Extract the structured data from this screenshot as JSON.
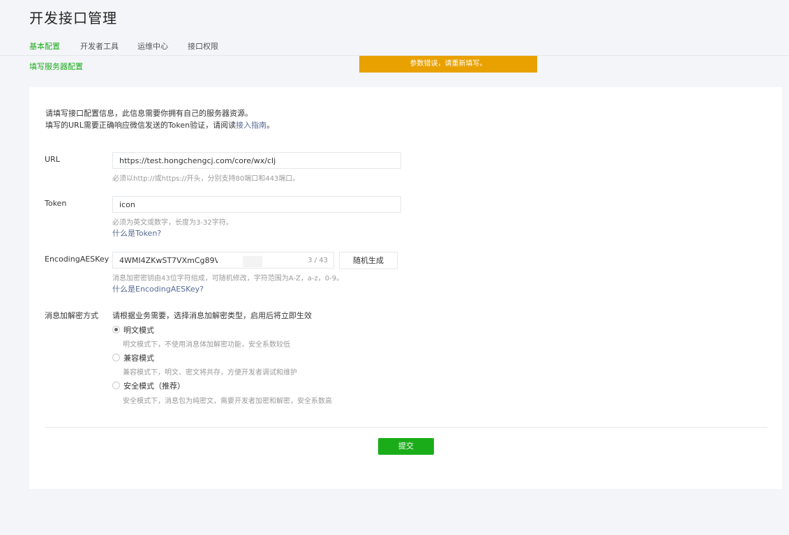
{
  "page": {
    "title": "开发接口管理"
  },
  "tabs": [
    {
      "label": "基本配置",
      "active": true
    },
    {
      "label": "开发者工具",
      "active": false
    },
    {
      "label": "运维中心",
      "active": false
    },
    {
      "label": "接口权限",
      "active": false
    }
  ],
  "sub_link": "填写服务器配置",
  "toast": "参数错误，请重新填写。",
  "intro": {
    "line1": "请填写接口配置信息，此信息需要你拥有自己的服务器资源。",
    "line2_prefix": "填写的URL需要正确响应微信发送的Token验证，请阅读",
    "line2_link": "接入指南",
    "line2_suffix": "。"
  },
  "url": {
    "label": "URL",
    "value": "https://test.hongchengcj.com/core/wx/clj",
    "hint": "必须以http://或https://开头，分别支持80端口和443端口。"
  },
  "token": {
    "label": "Token",
    "value": "icon",
    "hint": "必须为英文或数字，长度为3-32字符。",
    "help": "什么是Token?"
  },
  "aes": {
    "label": "EncodingAESKey",
    "value": "4WMI4ZKwST7VXmCg89VtL",
    "count": "3 / 43",
    "random_button": "随机生成",
    "hint": "消息加密密钥由43位字符组成，可随机修改，字符范围为A-Z，a-z，0-9。",
    "help": "什么是EncodingAESKey?"
  },
  "encryption": {
    "label": "消息加解密方式",
    "description": "请根据业务需要，选择消息加解密类型，启用后将立即生效",
    "options": [
      {
        "label": "明文模式",
        "desc": "明文模式下，不使用消息体加解密功能，安全系数较低",
        "checked": true
      },
      {
        "label": "兼容模式",
        "desc": "兼容模式下，明文、密文将共存，方便开发者调试和维护",
        "checked": false
      },
      {
        "label": "安全模式（推荐）",
        "desc": "安全模式下，消息包为纯密文，需要开发者加密和解密，安全系数高",
        "checked": false
      }
    ]
  },
  "submit_label": "提交",
  "colors": {
    "accent": "#1aad19",
    "toast": "#e9a100",
    "link": "#576b95"
  }
}
